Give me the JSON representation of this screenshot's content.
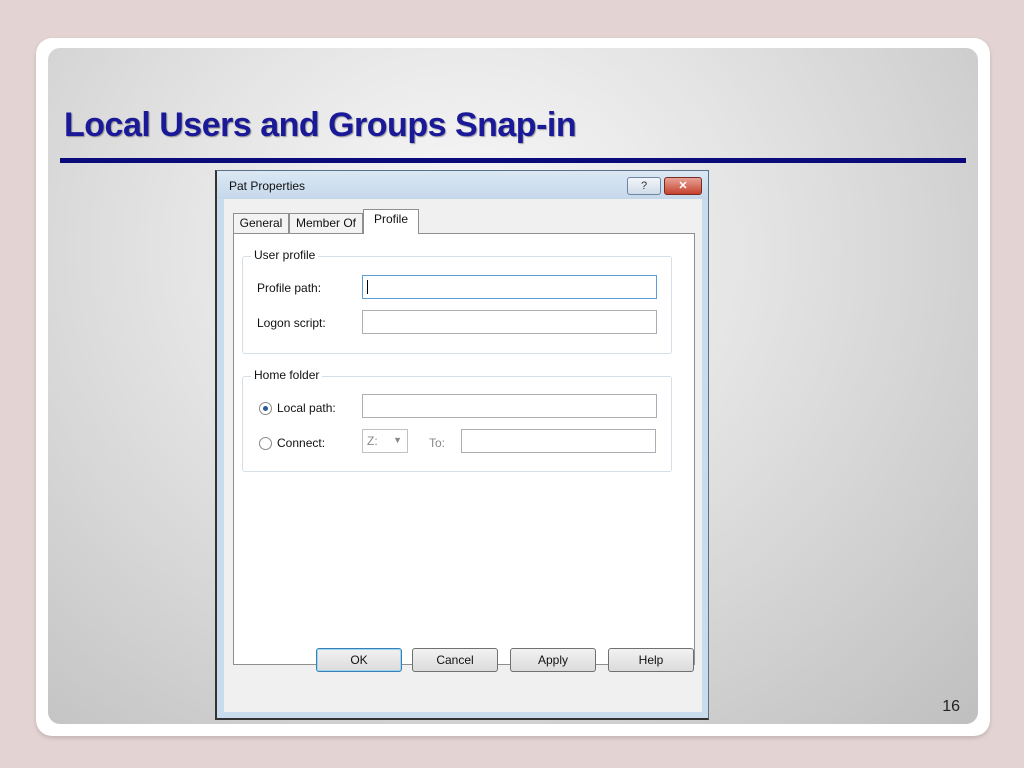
{
  "slide": {
    "title": "Local Users and Groups Snap-in",
    "page_number": "16"
  },
  "dialog": {
    "title": "Pat Properties",
    "titlebar_buttons": {
      "help": "?",
      "close": "✕"
    },
    "tabs": [
      {
        "label": "General",
        "selected": false
      },
      {
        "label": "Member Of",
        "selected": false
      },
      {
        "label": "Profile",
        "selected": true
      }
    ],
    "user_profile": {
      "legend": "User profile",
      "profile_path_label": "Profile path:",
      "profile_path_value": "",
      "logon_script_label": "Logon script:",
      "logon_script_value": ""
    },
    "home_folder": {
      "legend": "Home folder",
      "local_path_label": "Local path:",
      "local_path_value": "",
      "local_path_selected": true,
      "connect_label": "Connect:",
      "connect_drive": "Z:",
      "to_label": "To:",
      "to_value": ""
    },
    "buttons": {
      "ok": "OK",
      "cancel": "Cancel",
      "apply": "Apply",
      "help": "Help"
    }
  }
}
